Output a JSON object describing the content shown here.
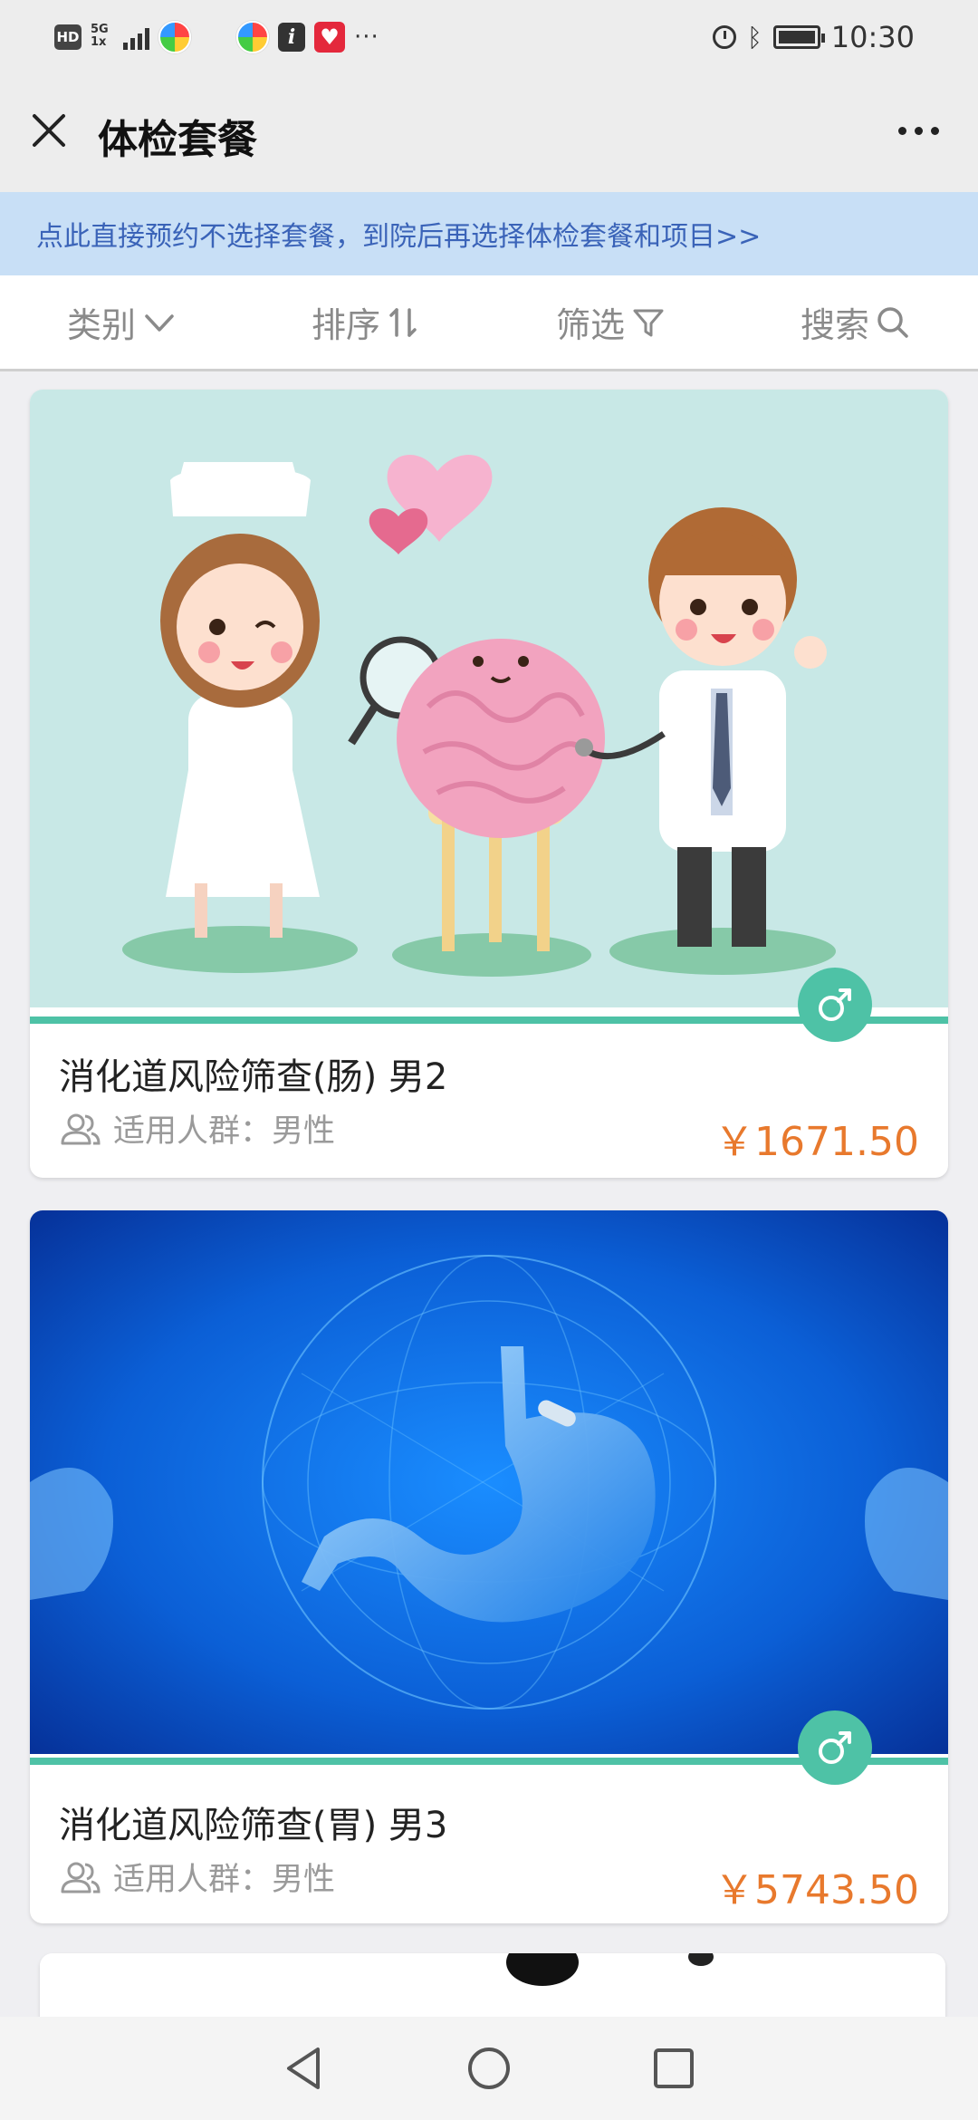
{
  "status_bar": {
    "hd": "HD",
    "network": "5G",
    "network_sub": "1x",
    "time": "10:30",
    "app_info_glyph": "i",
    "more": "···",
    "icons": [
      "signal-icon",
      "app-icon",
      "info-app-icon",
      "health-app-icon",
      "alarm-icon",
      "bluetooth-icon",
      "battery-icon"
    ]
  },
  "header": {
    "title": "体检套餐",
    "close_icon": "close-icon",
    "more_icon": "more-icon"
  },
  "banner": {
    "text": "点此直接预约不选择套餐，到院后再选择体检套餐和项目>>"
  },
  "filters": [
    {
      "label": "类别",
      "icon": "chevron-down-icon"
    },
    {
      "label": "排序",
      "icon": "sort-icon"
    },
    {
      "label": "筛选",
      "icon": "filter-icon"
    },
    {
      "label": "搜索",
      "icon": "search-icon"
    }
  ],
  "packages": [
    {
      "title": "消化道风险筛查(肠) 男2",
      "audience_label": "适用人群：",
      "audience": "男性",
      "price": "￥1671.50",
      "gender_icon": "male-icon",
      "image": "doctor-nurse-intestine-illustration"
    },
    {
      "title": "消化道风险筛查(胃) 男3",
      "audience_label": "适用人群：",
      "audience": "男性",
      "price": "￥5743.50",
      "gender_icon": "male-icon",
      "image": "blue-stomach-illustration"
    }
  ],
  "colors": {
    "accent": "#4ec2a6",
    "price": "#e8792d",
    "banner_bg": "#c8dff6",
    "banner_text": "#3a63b8"
  }
}
